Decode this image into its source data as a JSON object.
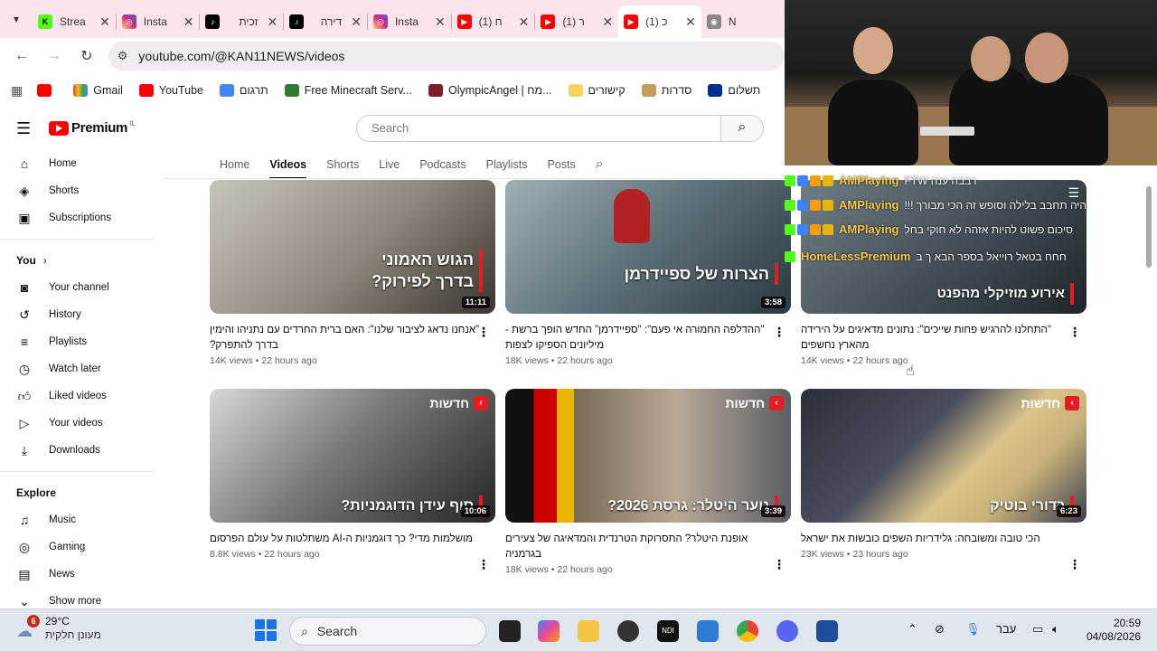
{
  "browser": {
    "tabs": [
      {
        "title": "Strea",
        "icon": "kick-icon",
        "color": "#53fc18"
      },
      {
        "title": "Insta",
        "icon": "instagram-icon",
        "color": "#d62976"
      },
      {
        "title": "זכית",
        "icon": "tiktok-icon",
        "color": "#000000"
      },
      {
        "title": "דירה",
        "icon": "tiktok-icon",
        "color": "#000000"
      },
      {
        "title": "Insta",
        "icon": "instagram-icon",
        "color": "#d62976"
      },
      {
        "title": "(1) ח",
        "icon": "youtube-icon",
        "color": "#ff0000"
      },
      {
        "title": "(1) ר",
        "icon": "youtube-icon",
        "color": "#ff0000"
      },
      {
        "title": "(1) כ",
        "icon": "youtube-icon",
        "color": "#ff0000"
      }
    ],
    "extra_tab": "N",
    "url": "youtube.com/@KAN11NEWS/videos",
    "bookmarks": [
      "Gmail",
      "YouTube",
      "תרגום",
      "Free Minecraft Serv...",
      "OlympicAngel | מח...",
      "קישורים",
      "סדרות",
      "תשלום"
    ]
  },
  "youtube": {
    "logo_text": "Premium",
    "logo_region": "IL",
    "search_placeholder": "Search",
    "sidebar": {
      "main": [
        "Home",
        "Shorts",
        "Subscriptions"
      ],
      "you_header": "You",
      "you": [
        "Your channel",
        "History",
        "Playlists",
        "Watch later",
        "Liked videos",
        "Your videos",
        "Downloads"
      ],
      "explore_header": "Explore",
      "explore": [
        "Music",
        "Gaming",
        "News",
        "Show more"
      ]
    },
    "channel_tabs": [
      "Home",
      "Videos",
      "Shorts",
      "Live",
      "Podcasts",
      "Playlists",
      "Posts"
    ],
    "active_tab": "Videos",
    "videos": [
      {
        "caption1": "הגוש האמוני",
        "caption2": "בדרך לפירוק?",
        "duration": "11:11",
        "title": "\"אנחנו נדאג לציבור שלנו\": האם ברית החרדים עם נתניהו והימין בדרך להתפרק?",
        "views": "14K views",
        "age": "22 hours ago",
        "badge": ""
      },
      {
        "caption1": "הצרות של ספיידרמן",
        "caption2": "",
        "duration": "3:58",
        "title": "\"ההדלפה החמורה אי פעם\": \"ספיידרמן\" החדש הופך ברשת - מיליונים הספיקו לצפות",
        "views": "18K views",
        "age": "22 hours ago",
        "badge": ""
      },
      {
        "caption1": "אירוע מוזיקלי מהפנט",
        "caption2": "",
        "duration": "",
        "title": "\"התחלנו להרגיש פחות שייכים\": נתונים מדאיגים על הירידה מהארץ נחשפים",
        "views": "14K views",
        "age": "22 hours ago",
        "badge": ""
      },
      {
        "caption1": "סוף עידן הדוגמניות?",
        "caption2": "",
        "duration": "10:06",
        "title": "מושלמות מדי? כך דוגמניות ה-AI משתלטות על עולם הפרסום",
        "views": "8.8K views",
        "age": "22 hours ago",
        "badge": "חדשות"
      },
      {
        "caption1": "נוער היטלר: גרסת 2026?",
        "caption2": "",
        "duration": "3:39",
        "title": "אופנת היטלר? התסרוקת הטרנדית והמדאיגה של צעירים בגרמניה",
        "views": "18K views",
        "age": "22 hours ago",
        "badge": "חדשות"
      },
      {
        "caption1": "כדורי בוטיק",
        "caption2": "",
        "duration": "6:23",
        "title": "הכי טובה ומשובחה: גלידריות השפים כובשות את ישראל",
        "views": "23K views",
        "age": "23 hours ago",
        "badge": "חדשות"
      }
    ]
  },
  "overlay": {
    "chat": [
      {
        "user": "AMPlaying",
        "msg": "רבבה ענה FTW"
      },
      {
        "user": "AMPlaying",
        "msg": "היה תחבב בלילה וסופש זה הכי מבורך !!!"
      },
      {
        "user": "AMPlaying",
        "msg": "סיכום פשוט להיות אזהה לא חוקי בחל"
      },
      {
        "user": "HomeLessPremium",
        "msg": "חחח בטאל רוייאל בספר הבא ך ב"
      }
    ]
  },
  "taskbar": {
    "temp": "29°C",
    "weather_desc": "מעונן חלקית",
    "weather_badge": "6",
    "search": "Search",
    "lang": "עבר",
    "time": "20:59",
    "date": "04/08/2026"
  }
}
